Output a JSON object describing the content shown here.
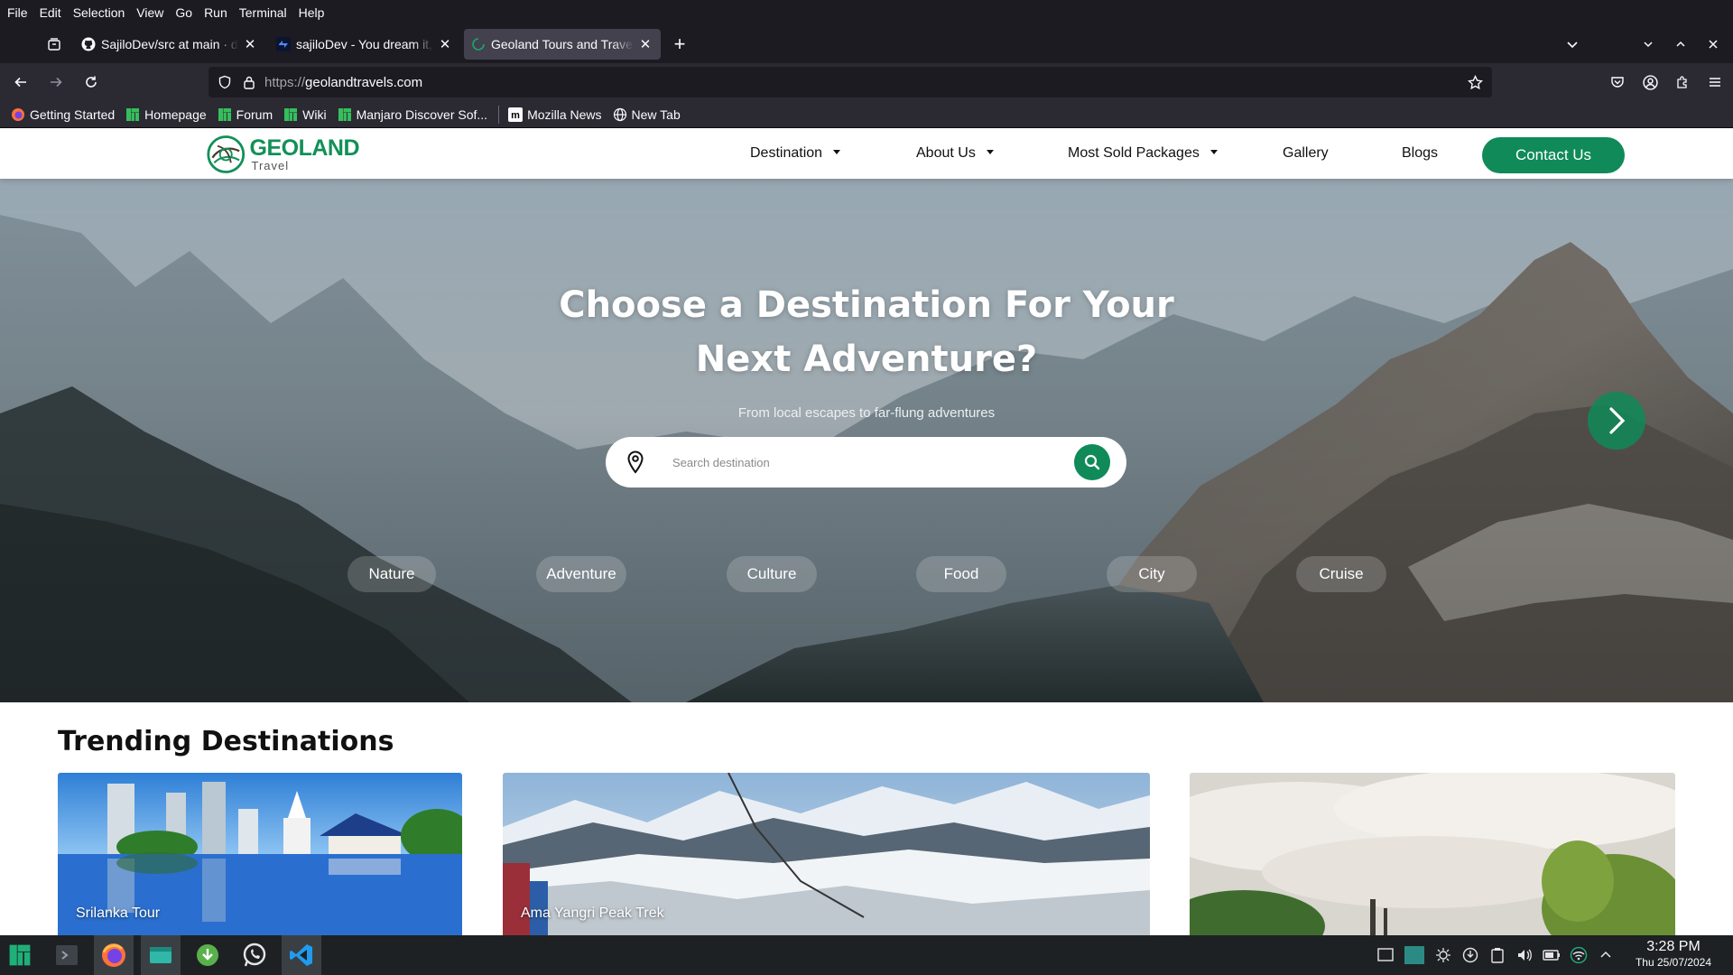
{
  "menubar": [
    "File",
    "Edit",
    "Selection",
    "View",
    "Go",
    "Run",
    "Terminal",
    "Help"
  ],
  "tabs": [
    {
      "title": "SajiloDev/src at main · dipe",
      "icon": "github-icon",
      "active": false
    },
    {
      "title": "sajiloDev - You dream it, W",
      "icon": "sajilodev-icon",
      "active": false
    },
    {
      "title": "Geoland Tours and Travels",
      "icon": "geoland-favicon-icon",
      "active": true
    }
  ],
  "url": {
    "proto": "https://",
    "host": "geolandtravels.com"
  },
  "bookmarks": [
    {
      "label": "Getting Started",
      "icon": "firefox-icon"
    },
    {
      "label": "Homepage",
      "icon": "manjaro-icon"
    },
    {
      "label": "Forum",
      "icon": "manjaro-icon"
    },
    {
      "label": "Wiki",
      "icon": "manjaro-icon"
    },
    {
      "label": "Manjaro Discover Sof...",
      "icon": "manjaro-icon"
    },
    {
      "label": "Mozilla News",
      "icon": "mozilla-icon"
    },
    {
      "label": "New Tab",
      "icon": "globe-icon"
    }
  ],
  "site": {
    "logo": {
      "brand": "GEOLAND",
      "sub": "Travel"
    },
    "nav": [
      {
        "label": "Destination",
        "dropdown": true
      },
      {
        "label": "About Us",
        "dropdown": true
      },
      {
        "label": "Most Sold Packages",
        "dropdown": true
      },
      {
        "label": "Gallery",
        "dropdown": false
      },
      {
        "label": "Blogs",
        "dropdown": false
      }
    ],
    "contact": "Contact Us",
    "accent": "#0f8a58",
    "hero": {
      "title_line1": "Choose a Destination For Your",
      "title_line2": "Next Adventure?",
      "subtitle": "From local escapes to far-flung adventures",
      "search_placeholder": "Search destination",
      "categories": [
        "Nature",
        "Adventure",
        "Culture",
        "Food",
        "City",
        "Cruise"
      ]
    },
    "trending": {
      "title": "Trending Destinations",
      "cards": [
        "Srilanka Tour",
        "Ama Yangri Peak Trek",
        ""
      ]
    }
  },
  "taskbar": {
    "apps": [
      "manjaro-menu-icon",
      "terminal-icon",
      "firefox-icon",
      "files-icon",
      "downloader-icon",
      "whatsapp-icon",
      "vscode-icon"
    ],
    "time": "3:28 PM",
    "date": "Thu 25/07/2024"
  }
}
